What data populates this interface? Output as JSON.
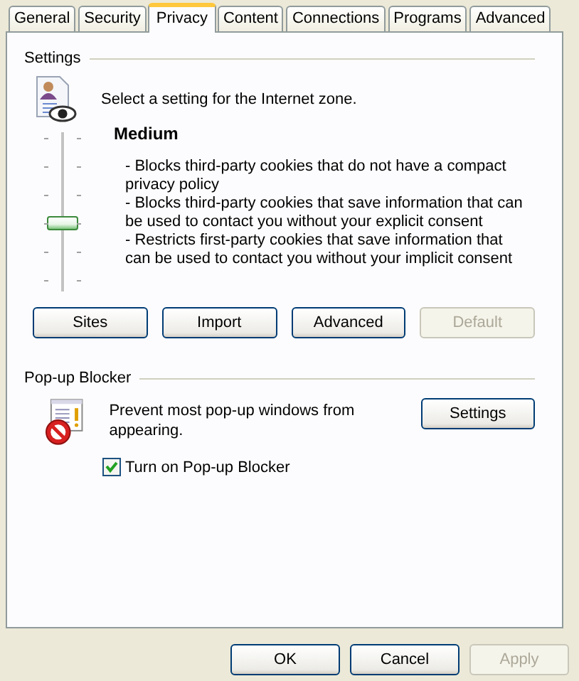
{
  "tabs": [
    {
      "label": "General",
      "selected": false
    },
    {
      "label": "Security",
      "selected": false
    },
    {
      "label": "Privacy",
      "selected": true
    },
    {
      "label": "Content",
      "selected": false
    },
    {
      "label": "Connections",
      "selected": false
    },
    {
      "label": "Programs",
      "selected": false
    },
    {
      "label": "Advanced",
      "selected": false
    }
  ],
  "settings": {
    "title": "Settings",
    "prompt": "Select a setting for the Internet zone.",
    "slider": {
      "level": 0.4
    },
    "level_name": "Medium",
    "description": [
      "- Blocks third-party cookies that do not have a compact privacy policy",
      "- Blocks third-party cookies that save information that can be used to contact you without your explicit consent",
      "- Restricts first-party cookies that save information that can be used to contact you without your implicit consent"
    ],
    "buttons": [
      {
        "label": "Sites",
        "disabled": false
      },
      {
        "label": "Import",
        "disabled": false
      },
      {
        "label": "Advanced",
        "disabled": false
      },
      {
        "label": "Default",
        "disabled": true
      }
    ]
  },
  "popup_blocker": {
    "title": "Pop-up Blocker",
    "text": "Prevent most pop-up windows from appearing.",
    "settings_button": {
      "label": "Settings",
      "disabled": false
    },
    "checkbox": {
      "label": "Turn on Pop-up Blocker",
      "checked": true
    }
  },
  "buttons": [
    {
      "label": "OK",
      "disabled": false
    },
    {
      "label": "Cancel",
      "disabled": false
    },
    {
      "label": "Apply",
      "disabled": true
    }
  ]
}
